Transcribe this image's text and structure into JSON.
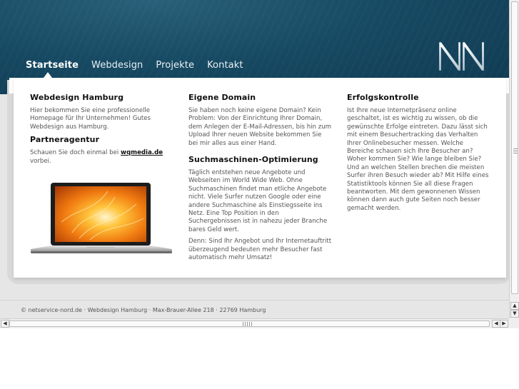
{
  "nav": {
    "items": [
      {
        "label": "Startseite",
        "active": true
      },
      {
        "label": "Webdesign",
        "active": false
      },
      {
        "label": "Projekte",
        "active": false
      },
      {
        "label": "Kontakt",
        "active": false
      }
    ]
  },
  "logo": {
    "text": "NN"
  },
  "columns": {
    "col1": {
      "heading1": "Webdesign Hamburg",
      "text1": "Hier bekommen Sie eine professionelle Homepage für Ihr Unternehmen! Gutes Webdesign aus Hamburg.",
      "heading2": "Partneragentur",
      "text2_before": "Schauen Sie doch einmal bei ",
      "text2_link": "wqmedia.de",
      "text2_after": " vorbei."
    },
    "col2": {
      "heading1": "Eigene Domain",
      "text1": "Sie haben noch keine eigene Domain? Kein Problem: Von der Einrichtung Ihrer Domain, dem Anlegen der E-Mail-Adressen, bis hin zum Upload Ihrer neuen Website bekommen Sie bei mir alles aus einer Hand.",
      "heading2": "Suchmaschinen-Optimierung",
      "text2": "Täglich entstehen neue Angebote und Webseiten im World Wide Web. Ohne Suchmaschinen findet man etliche Angebote nicht. Viele Surfer nutzen Google oder eine andere Suchmaschine als Einstiegsseite ins Netz. Eine Top Position in den Suchergebnissen ist in nahezu jeder Branche bares Geld wert.",
      "text3": "Denn: Sind Ihr Angebot und Ihr Internetauftritt überzeugend bedeuten mehr Besucher fast automatisch mehr Umsatz!"
    },
    "col3": {
      "heading1": "Erfolgskontrolle",
      "text1": "Ist Ihre neue Internetpräsenz online geschaltet, ist es wichtig zu wissen, ob die gewünschte Erfolge eintreten. Dazu lässt sich mit einem Besuchertracking das Verhalten Ihrer Onlinebesucher messen. Welche Bereiche schauen sich Ihre Besucher an? Woher kommen Sie? Wie lange bleiben Sie? Und an welchen Stellen brechen die meisten Surfer ihren Besuch wieder ab? Mit Hilfe eines Statistiktools können Sie all diese Fragen beantworten. Mit dem gewonnenen Wissen können dann auch gute Seiten noch besser gemacht werden."
    }
  },
  "footer": {
    "text": "© netservice-nord.de · Webdesign Hamburg · Max-Brauer-Allee 218 · 22769 Hamburg"
  },
  "scrollbars": {
    "up_arrow": "▲",
    "down_arrow": "▼",
    "left_arrow": "◀",
    "right_arrow": "▶"
  },
  "colors": {
    "header_bg": "#174a63",
    "page_bg": "#e6e6e6",
    "content_bg": "#ffffff"
  }
}
